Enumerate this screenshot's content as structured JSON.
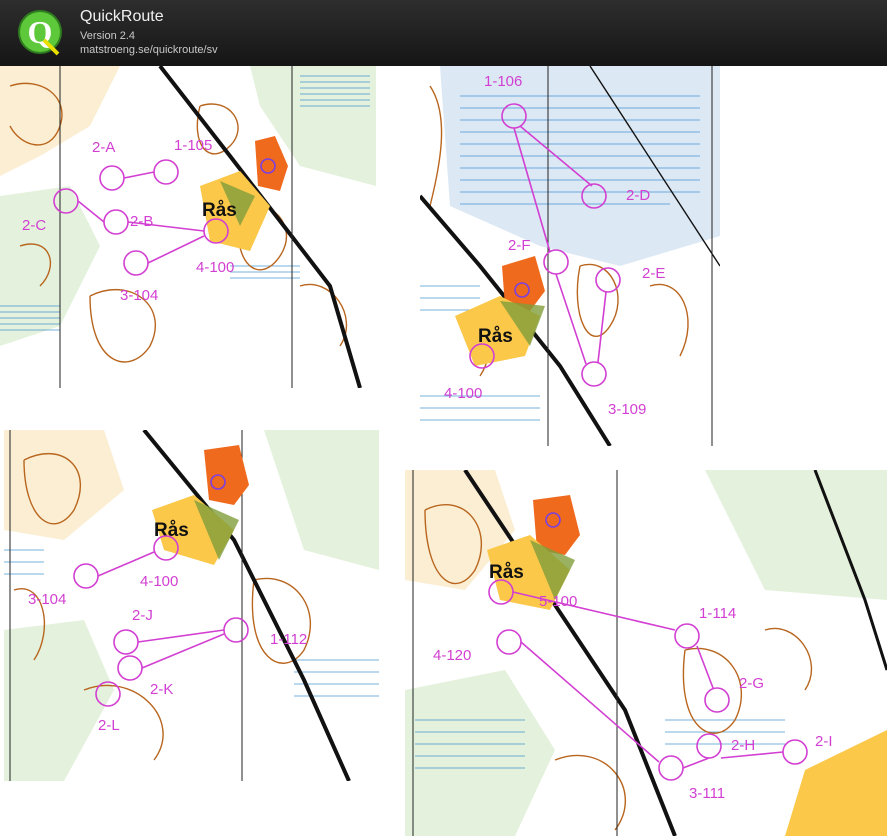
{
  "header": {
    "title": "QuickRoute",
    "version": "Version 2.4",
    "url": "matstroeng.se/quickroute/sv"
  },
  "colors": {
    "control_magenta": "#d23fd2",
    "route_blue": "#7a3fe0",
    "forest_white": "#ffffff",
    "open_yellow": "#fbc84a",
    "marsh_blue": "#3a8fd0",
    "contour_brown": "#b8651e",
    "rough_green": "#5aa83a",
    "header_bg": "#1e1e1e"
  },
  "maps": [
    {
      "place": "Rås",
      "controls": [
        "2-A",
        "1-105",
        "2-C",
        "2-B",
        "4-100",
        "3-104"
      ]
    },
    {
      "place": "Rås",
      "controls": [
        "1-106",
        "2-D",
        "2-F",
        "2-E",
        "4-100",
        "3-109"
      ]
    },
    {
      "place": "Rås",
      "controls": [
        "3-104",
        "4-100",
        "2-J",
        "1-112",
        "2-K",
        "2-L"
      ]
    },
    {
      "place": "Rås",
      "controls": [
        "5-100",
        "1-114",
        "4-120",
        "2-G",
        "2-H",
        "2-I",
        "3-111"
      ]
    }
  ]
}
